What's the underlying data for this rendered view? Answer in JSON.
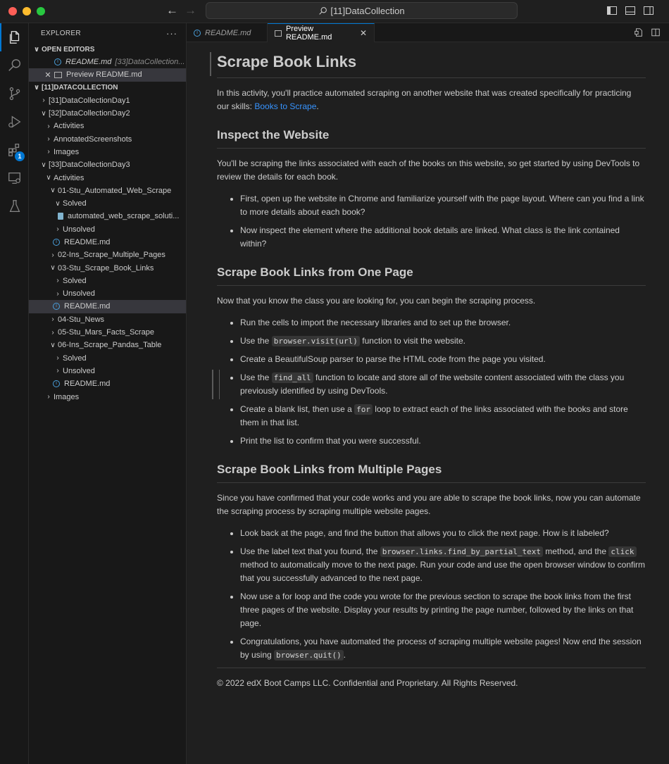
{
  "window": {
    "search_text": "[11]DataCollection"
  },
  "explorer": {
    "title": "EXPLORER",
    "more": "···",
    "open_editors_title": "OPEN EDITORS",
    "open_editors": [
      {
        "name": "README.md",
        "desc": "[33]DataCollection..."
      },
      {
        "name": "Preview README.md"
      }
    ],
    "folder_title": "[11]DATACOLLECTION",
    "tree": {
      "day1": "[31]DataCollectionDay1",
      "day2": "[32]DataCollectionDay2",
      "day2_activities": "Activities",
      "day2_annotated": "AnnotatedScreenshots",
      "day2_images": "Images",
      "day3": "[33]DataCollectionDay3",
      "day3_activities": "Activities",
      "a01": "01-Stu_Automated_Web_Scrape",
      "a01_solved": "Solved",
      "a01_solved_file": "automated_web_scrape_soluti...",
      "a01_unsolved": "Unsolved",
      "a01_readme": "README.md",
      "a02": "02-Ins_Scrape_Multiple_Pages",
      "a03": "03-Stu_Scrape_Book_Links",
      "a03_solved": "Solved",
      "a03_unsolved": "Unsolved",
      "a03_readme": "README.md",
      "a04": "04-Stu_News",
      "a05": "05-Stu_Mars_Facts_Scrape",
      "a06": "06-Ins_Scrape_Pandas_Table",
      "a06_solved": "Solved",
      "a06_unsolved": "Unsolved",
      "a06_readme": "README.md",
      "day3_images": "Images"
    }
  },
  "tabs": [
    {
      "label": "README.md"
    },
    {
      "label": "Preview README.md"
    }
  ],
  "activity_badge": "1",
  "doc": {
    "title": "Scrape Book Links",
    "intro_pre": "In this activity, you'll practice automated scraping on another website that was created specifically for practicing our skills: ",
    "intro_link": "Books to Scrape",
    "intro_post": ".",
    "h_inspect": "Inspect the Website",
    "inspect_p": "You'll be scraping the links associated with each of the books on this website, so get started by using DevTools to review the details for each book.",
    "inspect_li1": "First, open up the website in Chrome and familiarize yourself with the page layout. Where can you find a link to more details about each book?",
    "inspect_li2": "Now inspect the element where the additional book details are linked. What class is the link contained within?",
    "h_one": "Scrape Book Links from One Page",
    "one_p": "Now that you know the class you are looking for, you can begin the scraping process.",
    "one_li1": "Run the cells to import the necessary libraries and to set up the browser.",
    "one_li2_pre": "Use the ",
    "one_li2_code": "browser.visit(url)",
    "one_li2_post": " function to visit the website.",
    "one_li3": "Create a BeautifulSoup parser to parse the HTML code from the page you visited.",
    "one_li4_pre": "Use the ",
    "one_li4_code": "find_all",
    "one_li4_post": " function to locate and store all of the website content associated with the class you previously identified by using DevTools.",
    "one_li5_pre": "Create a blank list, then use a ",
    "one_li5_code": "for",
    "one_li5_post": " loop to extract each of the links associated with the books and store them in that list.",
    "one_li6": "Print the list to confirm that you were successful.",
    "h_multi": "Scrape Book Links from Multiple Pages",
    "multi_p": "Since you have confirmed that your code works and you are able to scrape the book links, now you can automate the scraping process by scraping multiple website pages.",
    "multi_li1": "Look back at the page, and find the button that allows you to click the next page. How is it labeled?",
    "multi_li2_pre": "Use the label text that you found, the ",
    "multi_li2_code1": "browser.links.find_by_partial_text",
    "multi_li2_mid": " method, and the ",
    "multi_li2_code2": "click",
    "multi_li2_post": " method to automatically move to the next page. Run your code and use the open browser window to confirm that you successfully advanced to the next page.",
    "multi_li3": "Now use a for loop and the code you wrote for the previous section to scrape the book links from the first three pages of the website. Display your results by printing the page number, followed by the links on that page.",
    "multi_li4_pre": "Congratulations, you have automated the process of scraping multiple website pages! Now end the session by using ",
    "multi_li4_code": "browser.quit()",
    "multi_li4_post": ".",
    "footer": "© 2022 edX Boot Camps LLC. Confidential and Proprietary. All Rights Reserved."
  }
}
